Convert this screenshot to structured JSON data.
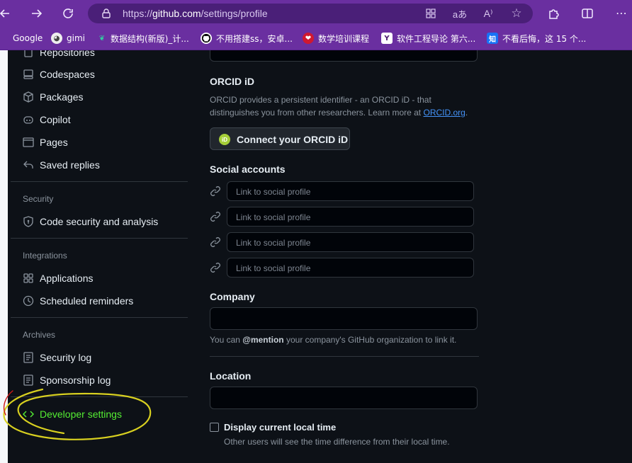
{
  "browser": {
    "url_prefix": "https://",
    "url_host": "github.com",
    "url_path": "/settings/profile",
    "icons": [
      "back-icon",
      "forward-icon",
      "refresh-icon",
      "lock-icon",
      "apps-icon",
      "translate-icon",
      "read-aloud-icon",
      "favorite-icon",
      "extensions-icon",
      "split-screen-icon",
      "more-icon"
    ],
    "bookmarks": [
      {
        "label": "Google"
      },
      {
        "label": "gimi"
      },
      {
        "label": "数据结构(新版)_计..."
      },
      {
        "label": "不用搭建ss，安卓..."
      },
      {
        "label": "数学培训课程"
      },
      {
        "label": "软件工程导论 第六..."
      },
      {
        "label": "不看后悔，这 15 个..."
      }
    ]
  },
  "sidebar": {
    "items_top": [
      {
        "label": "Repositories",
        "icon": "repo-icon"
      },
      {
        "label": "Codespaces",
        "icon": "codespaces-icon"
      },
      {
        "label": "Packages",
        "icon": "package-icon"
      },
      {
        "label": "Copilot",
        "icon": "copilot-icon"
      },
      {
        "label": "Pages",
        "icon": "browser-icon"
      },
      {
        "label": "Saved replies",
        "icon": "reply-icon"
      }
    ],
    "security": {
      "heading": "Security",
      "items": [
        {
          "label": "Code security and analysis",
          "icon": "shield-icon"
        }
      ]
    },
    "integrations": {
      "heading": "Integrations",
      "items": [
        {
          "label": "Applications",
          "icon": "apps-grid-icon"
        },
        {
          "label": "Scheduled reminders",
          "icon": "clock-icon"
        }
      ]
    },
    "archives": {
      "heading": "Archives",
      "items": [
        {
          "label": "Security log",
          "icon": "log-icon"
        },
        {
          "label": "Sponsorship log",
          "icon": "log-icon"
        }
      ]
    },
    "developer": {
      "label": "Developer settings",
      "icon": "code-icon",
      "color": "#55ee33"
    }
  },
  "main": {
    "orcid": {
      "heading": "ORCID iD",
      "desc_1": "ORCID provides a persistent identifier - an ORCID iD - that",
      "desc_2": "distinguishes you from other researchers. Learn more at",
      "link": "ORCID.org",
      "period": ".",
      "button": "Connect your ORCID iD"
    },
    "social": {
      "heading": "Social accounts",
      "placeholders": [
        "Link to social profile",
        "Link to social profile",
        "Link to social profile",
        "Link to social profile"
      ]
    },
    "company": {
      "heading": "Company",
      "value": "",
      "note_pre": "You can ",
      "note_strong": "@mention",
      "note_post": " your company's GitHub organization to link it."
    },
    "location": {
      "heading": "Location",
      "value": ""
    },
    "local_time": {
      "label": "Display current local time",
      "checked": false,
      "note": "Other users will see the time difference from their local time."
    }
  },
  "colors": {
    "browser": "#6a2fa0",
    "page_bg": "#0d1117",
    "link": "#4493f8",
    "highlight": "#55ee33",
    "annotation": "#d8d020"
  }
}
